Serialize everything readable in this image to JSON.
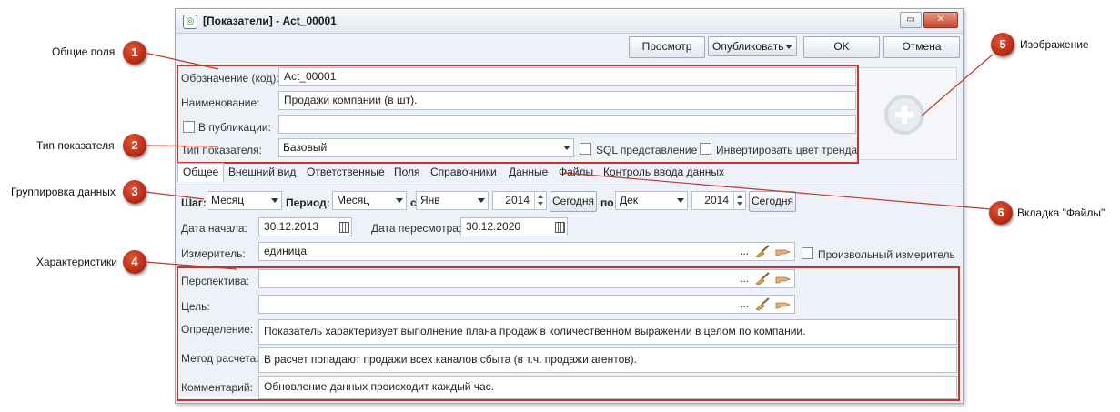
{
  "window": {
    "title": "[Показатели] - Act_00001",
    "controls": {
      "restore": "▭",
      "close": "✕"
    }
  },
  "toolbar": {
    "preview_label": "Просмотр",
    "publish_label": "Опубликовать",
    "ok_label": "OK",
    "cancel_label": "Отмена"
  },
  "general": {
    "code_label": "Обозначение (код):",
    "code_value": "Act_00001",
    "name_label": "Наименование:",
    "name_value": "Продажи компании (в шт).",
    "publication_label": "В публикации:",
    "publication_checked": false,
    "type_label": "Тип показателя:",
    "type_value": "Базовый",
    "sql_label": "SQL представление",
    "invert_label": "Инвертировать цвет тренда"
  },
  "tabs": [
    "Общее",
    "Внешний вид",
    "Ответственные",
    "Поля",
    "Справочники",
    "Данные",
    "Файлы",
    "Контроль ввода данных"
  ],
  "grouping": {
    "step_label": "Шаг:",
    "step_value": "Месяц",
    "period_label": "Период:",
    "period_value": "Месяц",
    "from_label": "с",
    "from_month": "Янв",
    "from_year": "2014",
    "today1": "Сегодня",
    "to_label": "по",
    "to_month": "Дек",
    "to_year": "2014",
    "today2": "Сегодня"
  },
  "dates": {
    "start_label": "Дата начала:",
    "start_value": "30.12.2013",
    "review_label": "Дата пересмотра:",
    "review_value": "30.12.2020"
  },
  "measure": {
    "label": "Измеритель:",
    "value": "единица",
    "ellipsis": "...",
    "custom_label": "Произвольный измеритель"
  },
  "characteristics": {
    "perspective_label": "Перспектива:",
    "perspective_ellipsis": "...",
    "goal_label": "Цель:",
    "goal_ellipsis": "...",
    "definition_label": "Определение:",
    "definition_value": "Показатель характеризует выполнение плана продаж в количественном выражении в целом по компании.",
    "method_label": "Метод расчета:",
    "method_value": "В расчет попадают продажи всех каналов сбыта (в т.ч. продажи агентов).",
    "comment_label": "Комментарий:",
    "comment_value": "Обновление данных происходит каждый час."
  },
  "callouts": [
    {
      "number": "1",
      "text": "Общие поля"
    },
    {
      "number": "2",
      "text": "Тип показателя"
    },
    {
      "number": "3",
      "text": "Группировка данных"
    },
    {
      "number": "4",
      "text": "Характеристики"
    },
    {
      "number": "5",
      "text": "Изображение"
    },
    {
      "number": "6",
      "text": "Вкладка \"Файлы\""
    }
  ],
  "colors": {
    "callout_red": "#c0392b",
    "window_bg": "#eef2f8"
  }
}
